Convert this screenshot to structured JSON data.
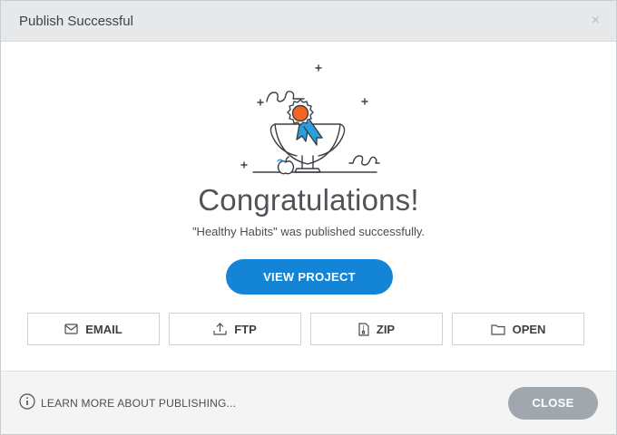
{
  "window": {
    "title": "Publish Successful",
    "close_glyph": "×"
  },
  "main": {
    "illustration_icon": "trophy-with-award-ribbon-illustration",
    "headline": "Congratulations!",
    "message": "\"Healthy Habits\" was published successfully.",
    "primary_button": "VIEW PROJECT",
    "actions": [
      {
        "label": "EMAIL",
        "icon": "envelope-icon"
      },
      {
        "label": "FTP",
        "icon": "upload-icon"
      },
      {
        "label": "ZIP",
        "icon": "zip-file-icon"
      },
      {
        "label": "OPEN",
        "icon": "folder-icon"
      }
    ]
  },
  "footer": {
    "learn_more": "LEARN MORE ABOUT PUBLISHING...",
    "close_button": "CLOSE"
  },
  "colors": {
    "primary": "#1485d6",
    "secondary_button": "#a1a7ae",
    "medal_orange": "#f26522",
    "ribbon_blue": "#2a9fe0",
    "titlebar_bg": "#e6e8ea",
    "footer_bg": "#f4f4f5"
  }
}
